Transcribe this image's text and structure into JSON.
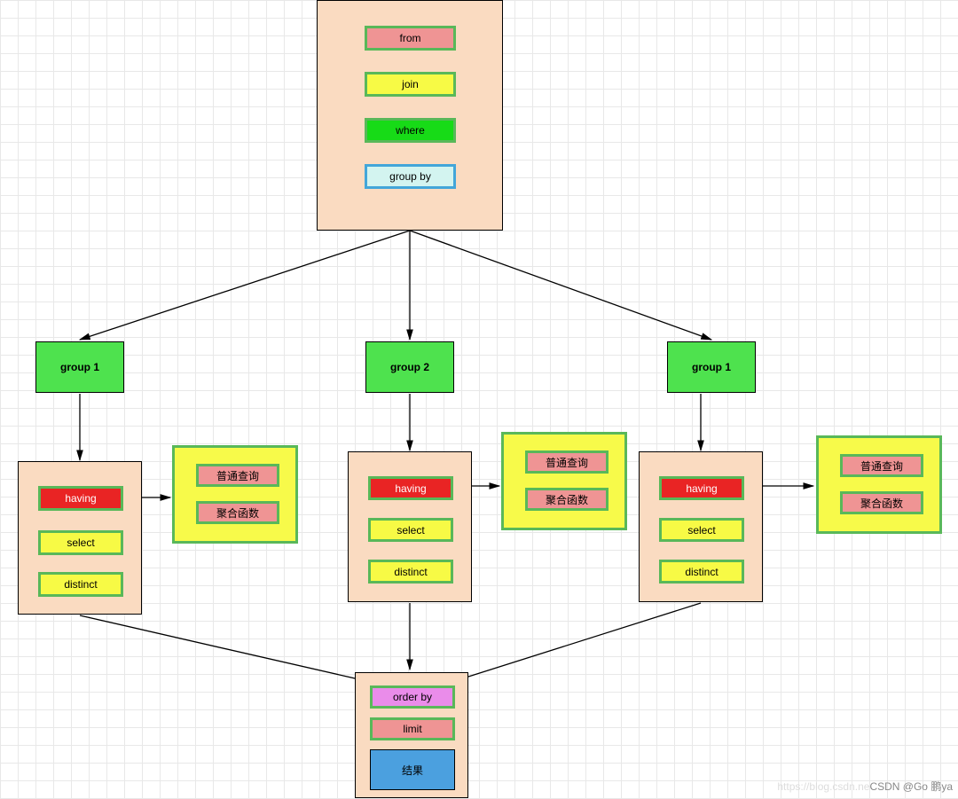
{
  "top": {
    "from": "from",
    "join": "join",
    "where": "where",
    "groupby": "group by"
  },
  "groups": {
    "g1": "group 1",
    "g2": "group 2",
    "g3": "group 1"
  },
  "inner": {
    "having": "having",
    "select": "select",
    "distinct": "distinct"
  },
  "query": {
    "normal": "普通查询",
    "agg": "聚合函数"
  },
  "bottom": {
    "orderby": "order by",
    "limit": "limit",
    "result": "结果"
  },
  "watermark": {
    "faint": "https://blog.csdn.ne",
    "text": "CSDN @Go 鹏ya"
  }
}
